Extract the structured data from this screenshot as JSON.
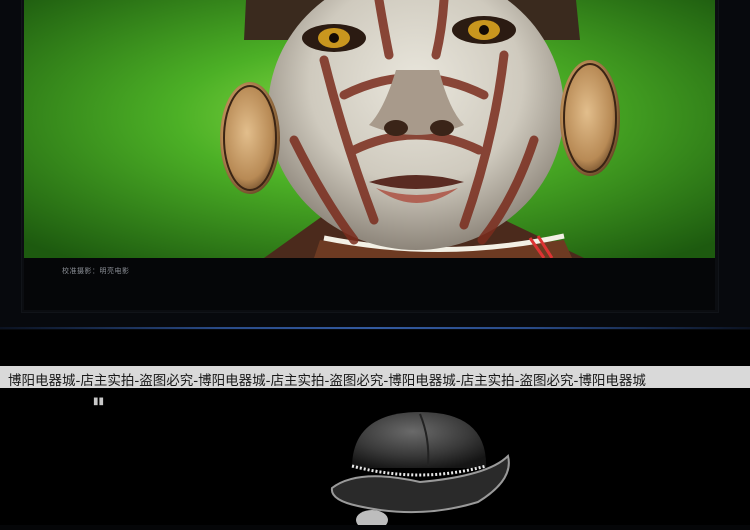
{
  "photo": {
    "subject": "portrait-with-white-face-paint",
    "caption": "校准摄影：明亮电影"
  },
  "watermark": {
    "text": "博阳电器城-店主实拍-盗图必究-博阳电器城-店主实拍-盗图必究-博阳电器城-店主实拍-盗图必究-博阳电器城"
  },
  "lower_image": {
    "mark": "▮▮"
  },
  "colors": {
    "accent_line": "#335aa0",
    "watermark_band": "#d9d9d9",
    "background": "#000000"
  }
}
